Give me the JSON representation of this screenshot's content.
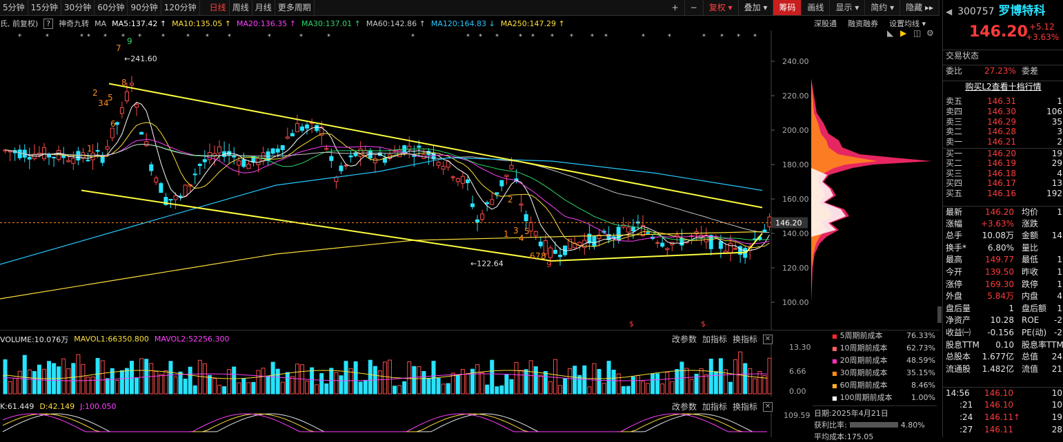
{
  "toolbar": {
    "periods": [
      "5分钟",
      "15分钟",
      "30分钟",
      "60分钟",
      "90分钟",
      "120分钟",
      "日线",
      "周线",
      "月线",
      "更多周期"
    ],
    "active_period": "日线",
    "right_buttons": [
      "+",
      "−",
      "复权",
      "叠加",
      "筹码",
      "画线",
      "显示",
      "简约",
      "隐藏"
    ]
  },
  "indicators": {
    "prefix": "氏, 前复权)",
    "help": "?",
    "tool": "神奇九转",
    "ma_label": "MA",
    "ma": [
      {
        "text": "MA5:137.42",
        "color": "#ffffff"
      },
      {
        "text": "MA10:135.05",
        "color": "#ffe03a"
      },
      {
        "text": "MA20:136.35",
        "color": "#ff40ff"
      },
      {
        "text": "MA30:137.01",
        "color": "#2fd86a"
      },
      {
        "text": "MA60:142.86",
        "color": "#c8c8c8"
      },
      {
        "text": "MA120:164.83",
        "color": "#27c8ff"
      },
      {
        "text": "MA250:147.29",
        "color": "#ffe03a"
      }
    ],
    "right_links": [
      "深股通",
      "融资融券",
      "设置均线"
    ]
  },
  "chart_data": [
    {
      "type": "candlestick",
      "title": "",
      "ylim": [
        90,
        250
      ],
      "y_ticks": [
        "240.00",
        "220.00",
        "200.00",
        "180.00",
        "160.00",
        "140.00",
        "120.00",
        "100.00"
      ],
      "current_price_label": "146.20",
      "annotations": [
        "241.60",
        "122.64"
      ],
      "nine_turn_up": [
        "1",
        "2",
        "3",
        "4",
        "5",
        "6",
        "7",
        "8",
        "9"
      ],
      "nine_turn_down": [
        "1",
        "2",
        "3",
        "4",
        "5",
        "6",
        "7",
        "8",
        "9"
      ]
    },
    {
      "type": "bar",
      "title": "VOLUME:10.076万",
      "series": [
        {
          "name": "MAVOL1:66350.800"
        },
        {
          "name": "MAVOL2:52256.300"
        }
      ],
      "y_ticks": [
        "13.30",
        "6.66",
        "0.00"
      ]
    },
    {
      "type": "line",
      "series": [
        {
          "name": "K:61.449"
        },
        {
          "name": "D:42.149"
        },
        {
          "name": "J:100.050"
        }
      ],
      "y_ticks": [
        "109.59"
      ]
    }
  ],
  "volume_panel": {
    "title": "VOLUME:10.076万",
    "mavol1": "MAVOL1:66350.800",
    "mavol2": "MAVOL2:52256.300",
    "links": [
      "改参数",
      "加指标",
      "换指标"
    ]
  },
  "kdj_panel": {
    "k": "K:61.449",
    "d": "D:42.149",
    "j": "J:100.050",
    "links": [
      "改参数",
      "加指标",
      "换指标"
    ]
  },
  "cost_legend": [
    {
      "label": "5周期前成本",
      "value": "76.33%",
      "color": "#ff2a2a"
    },
    {
      "label": "10周期前成本",
      "value": "62.73%",
      "color": "#ff6060"
    },
    {
      "label": "20周期前成本",
      "value": "48.59%",
      "color": "#ff30c0"
    },
    {
      "label": "30周期前成本",
      "value": "35.15%",
      "color": "#ff8c1a"
    },
    {
      "label": "60周期前成本",
      "value": "8.46%",
      "color": "#ffb030"
    },
    {
      "label": "100周期前成本",
      "value": "1.00%",
      "color": "#ffffff"
    }
  ],
  "cost_info": {
    "date_label": "日期:",
    "date": "2025年4月21日",
    "profit_label": "获利比率:",
    "profit": "4.80%",
    "avg_label": "平均成本:",
    "avg": "175.05"
  },
  "stock": {
    "code": "300757",
    "name": "罗博特科",
    "price": "146.20",
    "change": "+5.12",
    "change_pct": "+3.63%",
    "status": "交易状态",
    "weibi_label": "委比",
    "weibi": "27.23%",
    "weicha_label": "委差",
    "l2": "购买L2查看十档行情"
  },
  "asks": [
    {
      "label": "卖五",
      "price": "146.31",
      "vol": "1"
    },
    {
      "label": "卖四",
      "price": "146.30",
      "vol": "106"
    },
    {
      "label": "卖三",
      "price": "146.29",
      "vol": "35"
    },
    {
      "label": "卖二",
      "price": "146.28",
      "vol": "3"
    },
    {
      "label": "卖一",
      "price": "146.21",
      "vol": "2"
    }
  ],
  "bids": [
    {
      "label": "买一",
      "price": "146.20",
      "vol": "19"
    },
    {
      "label": "买二",
      "price": "146.19",
      "vol": "29"
    },
    {
      "label": "买三",
      "price": "146.18",
      "vol": "4"
    },
    {
      "label": "买四",
      "price": "146.17",
      "vol": "13"
    },
    {
      "label": "买五",
      "price": "146.16",
      "vol": "192"
    }
  ],
  "stats": [
    {
      "l1": "最新",
      "v1": "146.20",
      "v1c": "red",
      "l2": "均价",
      "v2": "1"
    },
    {
      "l1": "涨幅",
      "v1": "+3.63%",
      "v1c": "red",
      "l2": "涨跌",
      "v2": ""
    },
    {
      "l1": "总手",
      "v1": "10.08万",
      "v1c": "white",
      "l2": "金额",
      "v2": "14"
    },
    {
      "l1": "换手*",
      "v1": "6.80%",
      "v1c": "white",
      "l2": "量比",
      "v2": ""
    },
    {
      "l1": "最高",
      "v1": "149.77",
      "v1c": "red",
      "l2": "最低",
      "v2": "1"
    },
    {
      "l1": "今开",
      "v1": "139.50",
      "v1c": "red",
      "l2": "昨收",
      "v2": "1"
    },
    {
      "l1": "涨停",
      "v1": "169.30",
      "v1c": "red",
      "l2": "跌停",
      "v2": "1"
    },
    {
      "l1": "外盘",
      "v1": "5.84万",
      "v1c": "red",
      "l2": "内盘",
      "v2": "4"
    },
    {
      "l1": "盘后量",
      "v1": "1",
      "v1c": "white",
      "l2": "盘后额",
      "v2": "1"
    },
    {
      "l1": "净资产",
      "v1": "10.28",
      "v1c": "white",
      "l2": "ROE",
      "v2": "-2"
    },
    {
      "l1": "收益㈠",
      "v1": "-0.156",
      "v1c": "white",
      "l2": "PE(动)",
      "v2": "-2"
    },
    {
      "l1": "股息TTM",
      "v1": "0.10",
      "v1c": "white",
      "l2": "股息率TTM",
      "v2": ""
    },
    {
      "l1": "总股本",
      "v1": "1.677亿",
      "v1c": "white",
      "l2": "总值",
      "v2": "24"
    },
    {
      "l1": "流通股",
      "v1": "1.482亿",
      "v1c": "white",
      "l2": "流值",
      "v2": "21"
    }
  ],
  "ticks": [
    {
      "time": "14:56",
      "price": "146.10",
      "vol": "10"
    },
    {
      "time": ":21",
      "price": "146.10",
      "vol": "10"
    },
    {
      "time": ":24",
      "price": "146.11↑",
      "vol": "19"
    },
    {
      "time": ":27",
      "price": "146.11",
      "vol": "28"
    }
  ]
}
